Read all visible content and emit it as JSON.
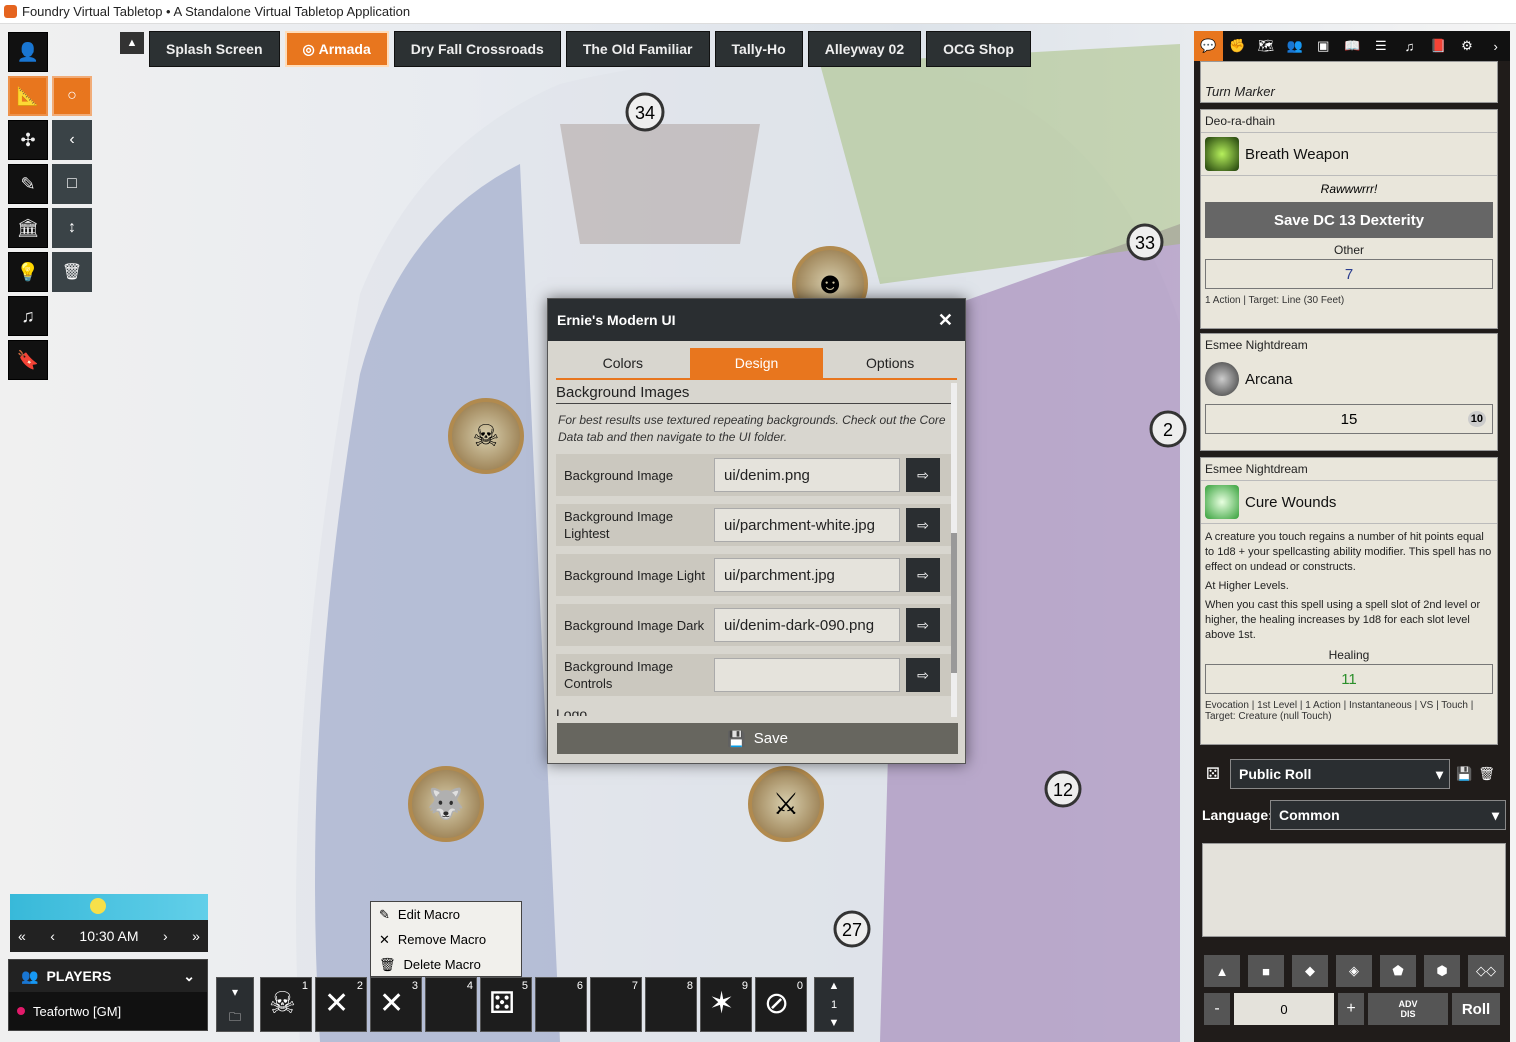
{
  "window": {
    "title": "Foundry Virtual Tabletop • A Standalone Virtual Tabletop Application"
  },
  "scenes": [
    "Splash Screen",
    "Armada",
    "Dry Fall Crossroads",
    "The Old Familiar",
    "Tally-Ho",
    "Alleyway 02",
    "OCG Shop"
  ],
  "active_scene": "Armada",
  "map_labels": [
    "34",
    "33",
    "2",
    "12",
    "27"
  ],
  "dialog": {
    "title": "Ernie's Modern UI",
    "tabs": [
      "Colors",
      "Design",
      "Options"
    ],
    "active_tab": "Design",
    "section": "Background Images",
    "hint": "For best results use textured repeating backgrounds. Check out the Core Data tab and then navigate to the UI folder.",
    "fields": [
      {
        "label": "Background Image",
        "value": "ui/denim.png"
      },
      {
        "label": "Background Image Lightest",
        "value": "ui/parchment-white.jpg"
      },
      {
        "label": "Background Image Light",
        "value": "ui/parchment.jpg"
      },
      {
        "label": "Background Image Dark",
        "value": "ui/denim-dark-090.png"
      },
      {
        "label": "Background Image Controls",
        "value": ""
      }
    ],
    "next_section": "Logo",
    "save_label": "Save"
  },
  "chat": {
    "turn_marker": "Turn Marker",
    "card1": {
      "speaker": "Deo-ra-dhain",
      "name": "Breath Weapon",
      "flavor": "Rawwwrrr!",
      "save": "Save DC 13 Dexterity",
      "other_label": "Other",
      "other_value": "7",
      "footer": "1 Action | Target: Line (30 Feet)"
    },
    "card2": {
      "speaker": "Esmee Nightdream",
      "name": "Arcana",
      "value": "15",
      "die": "10"
    },
    "card3": {
      "speaker": "Esmee Nightdream",
      "name": "Cure Wounds",
      "desc1": "A creature you touch regains a number of hit points equal to 1d8 + your spellcasting ability modifier. This spell has no effect on undead or constructs.",
      "higher": "At Higher Levels.",
      "desc2": "When you cast this spell using a spell slot of 2nd level or higher, the healing increases by 1d8 for each slot level above 1st.",
      "healing_label": "Healing",
      "healing_value": "11",
      "footer": "Evocation | 1st Level | 1 Action | Instantaneous | VS | Touch | Target: Creature (null Touch)"
    },
    "roll_mode": "Public Roll",
    "language_label": "Language:",
    "language": "Common",
    "modifier": "0",
    "adv": "ADV",
    "dis": "DIS",
    "roll_label": "Roll",
    "minus": "-",
    "plus": "+"
  },
  "clock": {
    "time": "10:30 AM"
  },
  "players": {
    "header": "PLAYERS",
    "user": "Teafortwo [GM]"
  },
  "hotbar": {
    "slots": [
      "1",
      "2",
      "3",
      "4",
      "5",
      "6",
      "7",
      "8",
      "9",
      "0"
    ],
    "page": "1"
  },
  "context_menu": [
    "Edit Macro",
    "Remove Macro",
    "Delete Macro"
  ],
  "colors": {
    "accent": "#e8761e",
    "dark": "#2a2e31",
    "parchment": "#e9e6db"
  }
}
